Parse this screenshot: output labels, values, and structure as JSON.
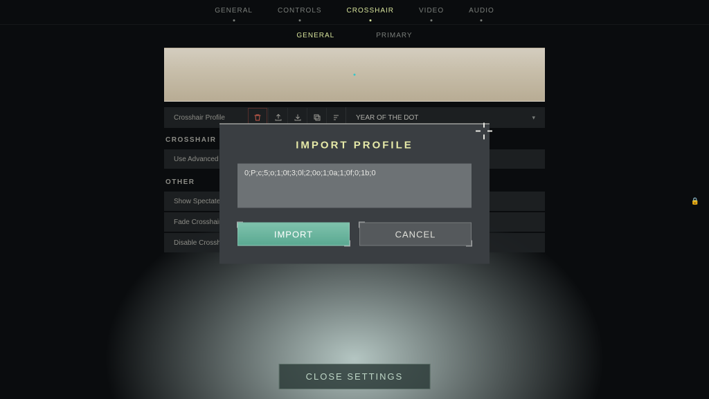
{
  "nav": {
    "main": [
      "GENERAL",
      "CONTROLS",
      "CROSSHAIR",
      "VIDEO",
      "AUDIO"
    ],
    "main_active_index": 2,
    "sub": [
      "GENERAL",
      "PRIMARY"
    ],
    "sub_active_index": 0
  },
  "profile": {
    "label": "Crosshair Profile",
    "selected": "YEAR OF THE DOT"
  },
  "sections": {
    "crosshair_header": "CROSSHAIR",
    "other_header": "OTHER",
    "rows": {
      "advanced": "Use Advanced Options",
      "spectated": "Show Spectated Player's Crosshair",
      "fade": "Fade Crosshair With Firing Error",
      "disable": "Disable Crosshair"
    }
  },
  "modal": {
    "title": "IMPORT PROFILE",
    "code": "0;P;c;5;o;1;0t;3;0l;2;0o;1;0a;1;0f;0;1b;0",
    "import_label": "IMPORT",
    "cancel_label": "CANCEL"
  },
  "footer": {
    "close_label": "CLOSE SETTINGS"
  }
}
